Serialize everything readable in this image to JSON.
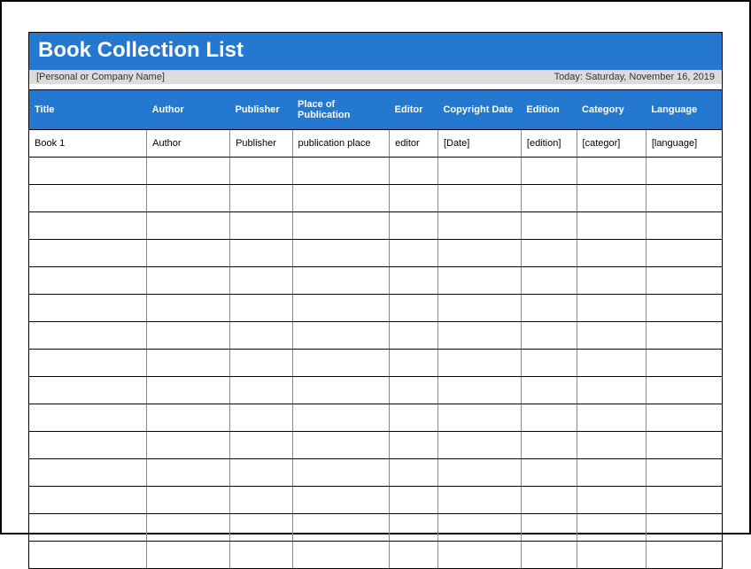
{
  "header": {
    "title": "Book Collection List",
    "org_name": "[Personal or Company Name]",
    "today_label": "Today:",
    "today_date": "Saturday, November 16, 2019"
  },
  "columns": [
    "Title",
    "Author",
    "Publisher",
    "Place of Publication",
    "Editor",
    "Copyright Date",
    "Edition",
    "Category",
    "Language"
  ],
  "rows": [
    {
      "title": "Book 1",
      "author": "Author",
      "publisher": "Publisher",
      "place": "publication place",
      "editor": "editor",
      "copyright": "[Date]",
      "edition": "[edition]",
      "category": "[categor]",
      "language": "[language]"
    },
    {
      "title": "",
      "author": "",
      "publisher": "",
      "place": "",
      "editor": "",
      "copyright": "",
      "edition": "",
      "category": "",
      "language": ""
    },
    {
      "title": "",
      "author": "",
      "publisher": "",
      "place": "",
      "editor": "",
      "copyright": "",
      "edition": "",
      "category": "",
      "language": ""
    },
    {
      "title": "",
      "author": "",
      "publisher": "",
      "place": "",
      "editor": "",
      "copyright": "",
      "edition": "",
      "category": "",
      "language": ""
    },
    {
      "title": "",
      "author": "",
      "publisher": "",
      "place": "",
      "editor": "",
      "copyright": "",
      "edition": "",
      "category": "",
      "language": ""
    },
    {
      "title": "",
      "author": "",
      "publisher": "",
      "place": "",
      "editor": "",
      "copyright": "",
      "edition": "",
      "category": "",
      "language": ""
    },
    {
      "title": "",
      "author": "",
      "publisher": "",
      "place": "",
      "editor": "",
      "copyright": "",
      "edition": "",
      "category": "",
      "language": ""
    },
    {
      "title": "",
      "author": "",
      "publisher": "",
      "place": "",
      "editor": "",
      "copyright": "",
      "edition": "",
      "category": "",
      "language": ""
    },
    {
      "title": "",
      "author": "",
      "publisher": "",
      "place": "",
      "editor": "",
      "copyright": "",
      "edition": "",
      "category": "",
      "language": ""
    },
    {
      "title": "",
      "author": "",
      "publisher": "",
      "place": "",
      "editor": "",
      "copyright": "",
      "edition": "",
      "category": "",
      "language": ""
    },
    {
      "title": "",
      "author": "",
      "publisher": "",
      "place": "",
      "editor": "",
      "copyright": "",
      "edition": "",
      "category": "",
      "language": ""
    },
    {
      "title": "",
      "author": "",
      "publisher": "",
      "place": "",
      "editor": "",
      "copyright": "",
      "edition": "",
      "category": "",
      "language": ""
    },
    {
      "title": "",
      "author": "",
      "publisher": "",
      "place": "",
      "editor": "",
      "copyright": "",
      "edition": "",
      "category": "",
      "language": ""
    },
    {
      "title": "",
      "author": "",
      "publisher": "",
      "place": "",
      "editor": "",
      "copyright": "",
      "edition": "",
      "category": "",
      "language": ""
    },
    {
      "title": "",
      "author": "",
      "publisher": "",
      "place": "",
      "editor": "",
      "copyright": "",
      "edition": "",
      "category": "",
      "language": ""
    },
    {
      "title": "",
      "author": "",
      "publisher": "",
      "place": "",
      "editor": "",
      "copyright": "",
      "edition": "",
      "category": "",
      "language": ""
    }
  ]
}
